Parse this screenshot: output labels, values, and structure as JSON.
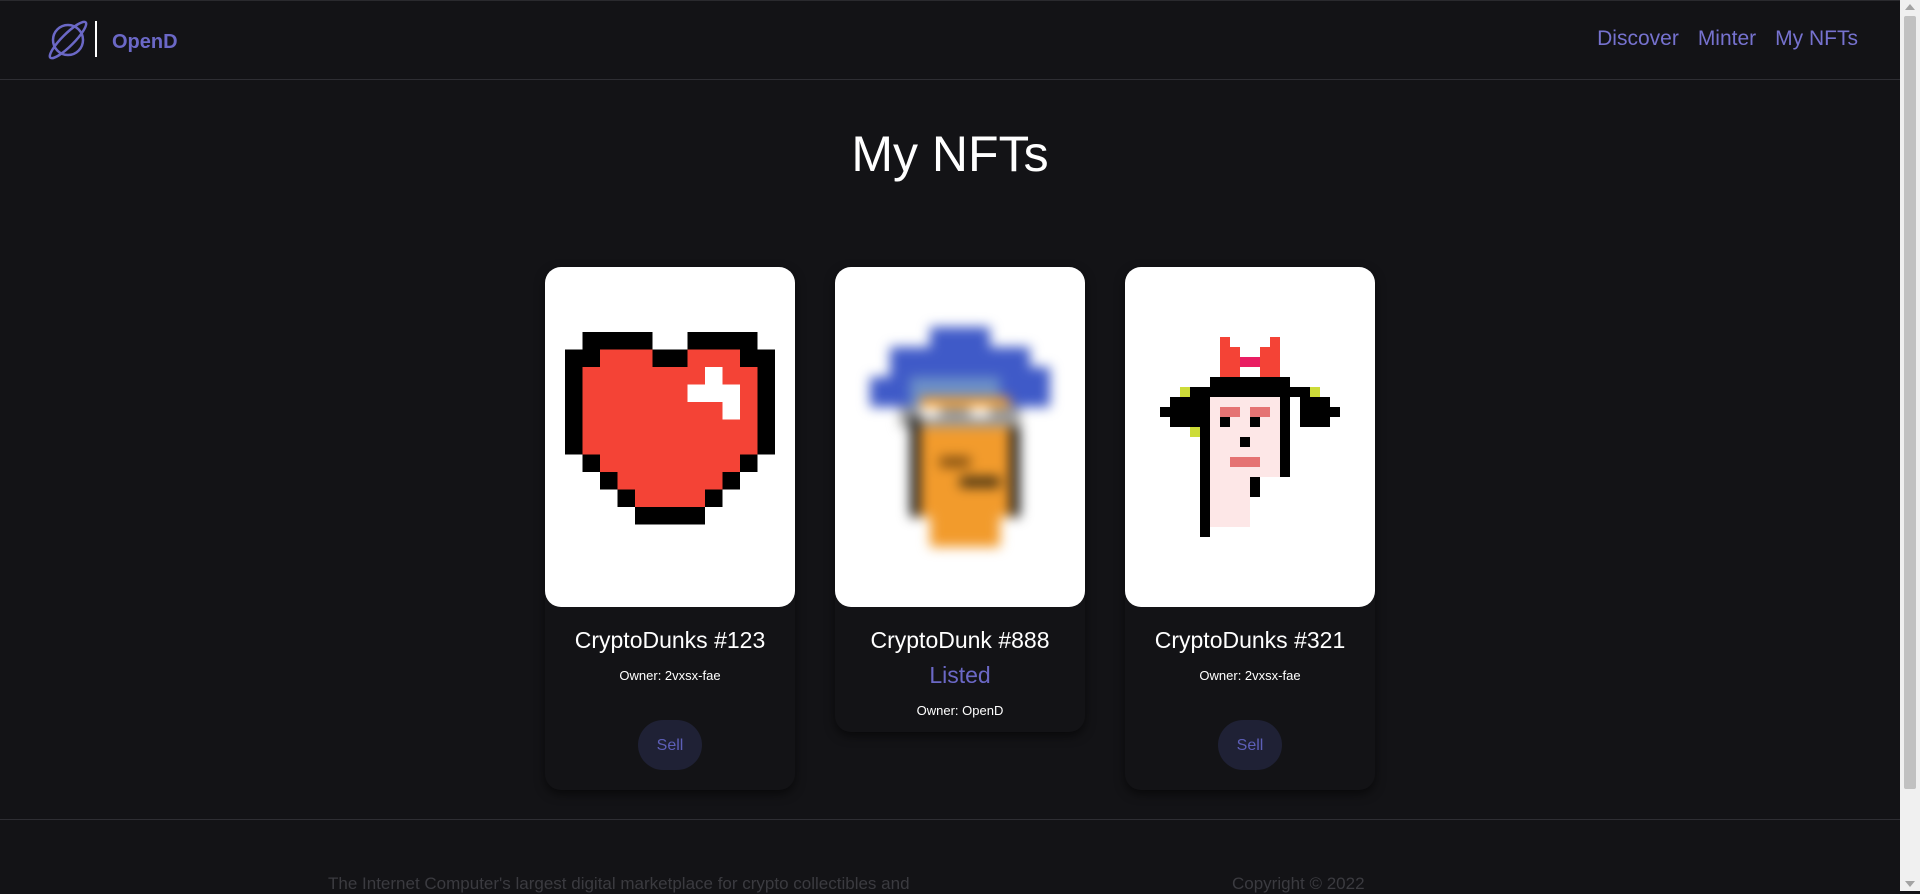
{
  "header": {
    "brand": "OpenD",
    "logo_icon": "planet-icon",
    "accent_color": "#6b68c6",
    "nav": [
      {
        "label": "Discover"
      },
      {
        "label": "Minter"
      },
      {
        "label": "My NFTs"
      }
    ]
  },
  "page": {
    "title": "My NFTs"
  },
  "cards": [
    {
      "name": "CryptoDunks #123",
      "owner": "Owner: 2vxsx-fae",
      "status": "",
      "button": "Sell",
      "image_icon": "pixel-heart-icon"
    },
    {
      "name": "CryptoDunk #888",
      "owner": "Owner: OpenD",
      "status": "Listed",
      "button": "",
      "image_icon": "pixel-punk-blue-hair-icon",
      "blurred": true
    },
    {
      "name": "CryptoDunks #321",
      "owner": "Owner: 2vxsx-fae",
      "status": "",
      "button": "Sell",
      "image_icon": "pixel-punk-red-horns-icon"
    }
  ],
  "footer": {
    "description": "The Internet Computer's largest digital marketplace for crypto collectibles and",
    "copyright": "Copyright © 2022"
  }
}
